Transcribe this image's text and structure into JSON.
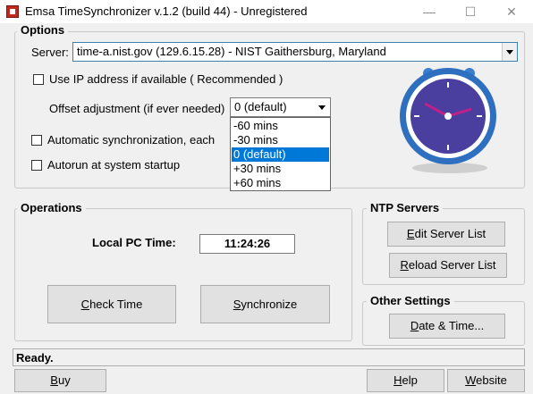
{
  "window": {
    "title": "Emsa TimeSynchronizer v.1.2  (build 44) - Unregistered",
    "minimize": "—",
    "maximize": "☐",
    "close": "✕"
  },
  "options": {
    "group_label": "Options",
    "server_label": "Server:",
    "server_value": "time-a.nist.gov (129.6.15.28)  - NIST Gaithersburg, Maryland",
    "use_ip_label": "Use IP address if available ( Recommended )",
    "offset_label": "Offset adjustment  (if ever needed)",
    "offset_value": "0 (default)",
    "offset_options": [
      "-60 mins",
      "-30 mins",
      "0 (default)",
      "+30 mins",
      "+60 mins"
    ],
    "offset_selected_index": 2,
    "auto_sync_label": "Automatic synchronization,  each",
    "autorun_label": "Autorun at system startup"
  },
  "operations": {
    "group_label": "Operations",
    "local_time_label": "Local PC Time:",
    "local_time_value": "11:24:26",
    "check_time_prefix": "",
    "check_time_ul": "C",
    "check_time_rest": "heck Time",
    "sync_ul": "S",
    "sync_rest": "ynchronize"
  },
  "ntp": {
    "group_label": "NTP Servers",
    "edit_ul": "E",
    "edit_rest": "dit Server List",
    "reload_ul": "R",
    "reload_rest": "eload Server List"
  },
  "other": {
    "group_label": "Other Settings",
    "date_ul": "D",
    "date_rest": "ate & Time..."
  },
  "status": {
    "text": "Ready."
  },
  "footer": {
    "buy_ul": "B",
    "buy_rest": "uy",
    "help_ul": "H",
    "help_rest": "elp",
    "website_ul": "W",
    "website_rest": "ebsite"
  },
  "colors": {
    "clock_ring": "#3a7fcf",
    "clock_face": "#4a3f9f",
    "clock_hands": "#c0208a",
    "selection": "#0078d7"
  },
  "icons": [
    "app-icon",
    "clock-icon"
  ]
}
